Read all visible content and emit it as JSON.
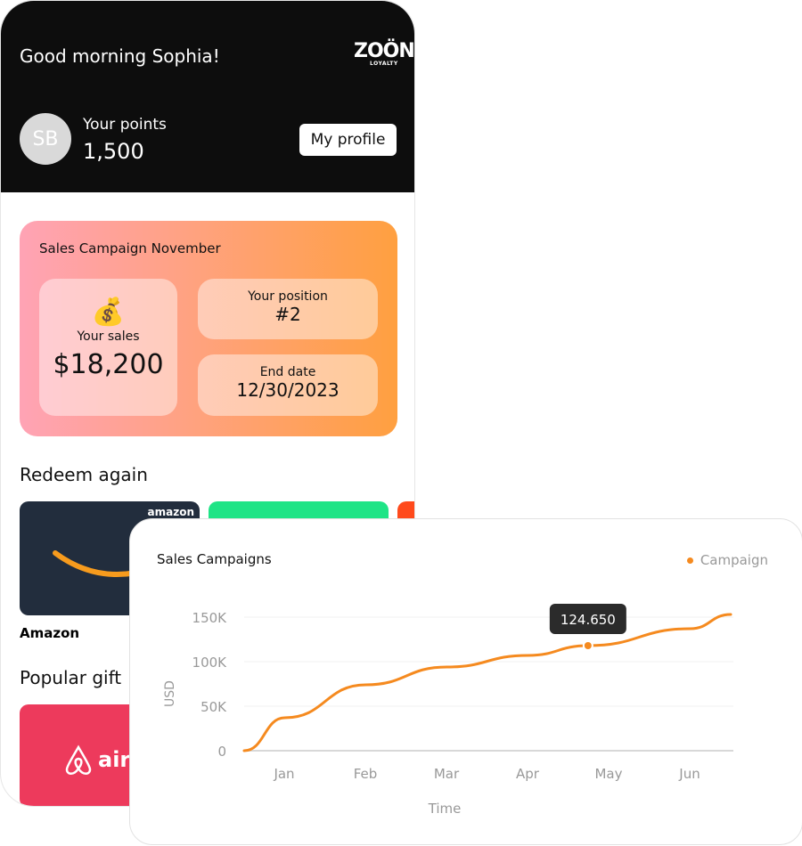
{
  "header": {
    "greeting": "Good morning Sophia!",
    "logo_main": "ZOÖN",
    "logo_sub": "LOYALTY",
    "avatar_initials": "SB",
    "points_label": "Your points",
    "points_value": "1,500",
    "profile_button": "My profile"
  },
  "campaign": {
    "title": "Sales Campaign November",
    "sales_icon": "money-bag-icon",
    "sales_emoji": "💰",
    "sales_label": "Your sales",
    "sales_value": "$18,200",
    "position_label": "Your position",
    "position_value": "#2",
    "end_label": "End date",
    "end_value": "12/30/2023"
  },
  "redeem": {
    "title": "Redeem again",
    "cards": [
      {
        "name": "Amazon",
        "logo": "amazon",
        "color": "#222d3d"
      },
      {
        "name": "",
        "color": "#1fe486"
      },
      {
        "name": "",
        "color": "#ff4a1c"
      }
    ]
  },
  "popular": {
    "title": "Popular gift",
    "cards": [
      {
        "logo": "airb",
        "color": "#ed3a5c"
      }
    ]
  },
  "chart_data": {
    "type": "line",
    "title": "Sales Campaigns",
    "xlabel": "Time",
    "ylabel": "USD",
    "legend": "top-right",
    "series": [
      {
        "name": "Campaign",
        "color": "#f58a1f",
        "points": [
          [
            0,
            0
          ],
          [
            1,
            37000
          ],
          [
            2,
            74000
          ],
          [
            3,
            94000
          ],
          [
            4,
            107000
          ],
          [
            4.74,
            118000
          ],
          [
            6,
            137000
          ],
          [
            6.5,
            153000
          ]
        ]
      }
    ],
    "categories": [
      "Jan",
      "Feb",
      "Mar",
      "Apr",
      "May",
      "Jun"
    ],
    "yticks": [
      "0",
      "50K",
      "100K",
      "150K"
    ],
    "ylim": [
      0,
      150000
    ],
    "grid": true,
    "tooltip": "124.650"
  }
}
